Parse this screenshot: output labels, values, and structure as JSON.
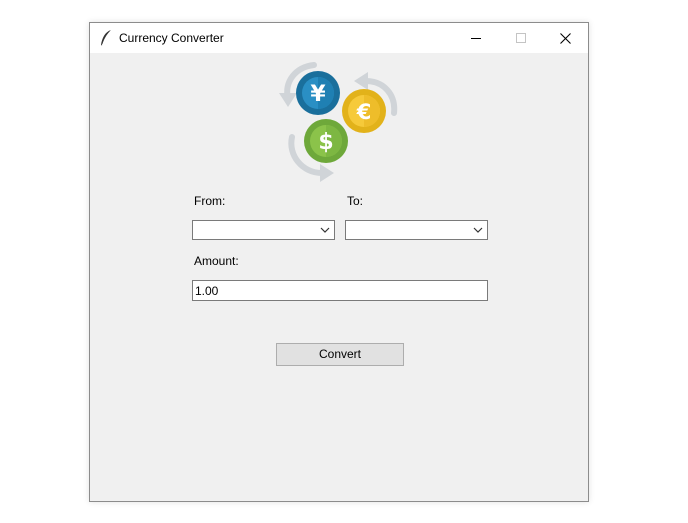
{
  "window": {
    "title": "Currency Converter",
    "app_icon": "feather-icon",
    "controls": {
      "minimize_icon": "minimize-icon",
      "maximize_icon": "maximize-icon",
      "close_icon": "close-icon"
    }
  },
  "logo": {
    "icon": "currency-exchange-icon",
    "symbols": {
      "yen": "¥",
      "euro": "€",
      "dollar": "$"
    },
    "colors": {
      "yen_coin": "#1a7bab",
      "euro_coin": "#f4c430",
      "dollar_coin": "#8bc34a",
      "arrows": "#d0d4d8"
    }
  },
  "form": {
    "from_label": "From:",
    "to_label": "To:",
    "amount_label": "Amount:",
    "from_value": "",
    "to_value": "",
    "amount_value": "1.00",
    "convert_label": "Convert"
  }
}
